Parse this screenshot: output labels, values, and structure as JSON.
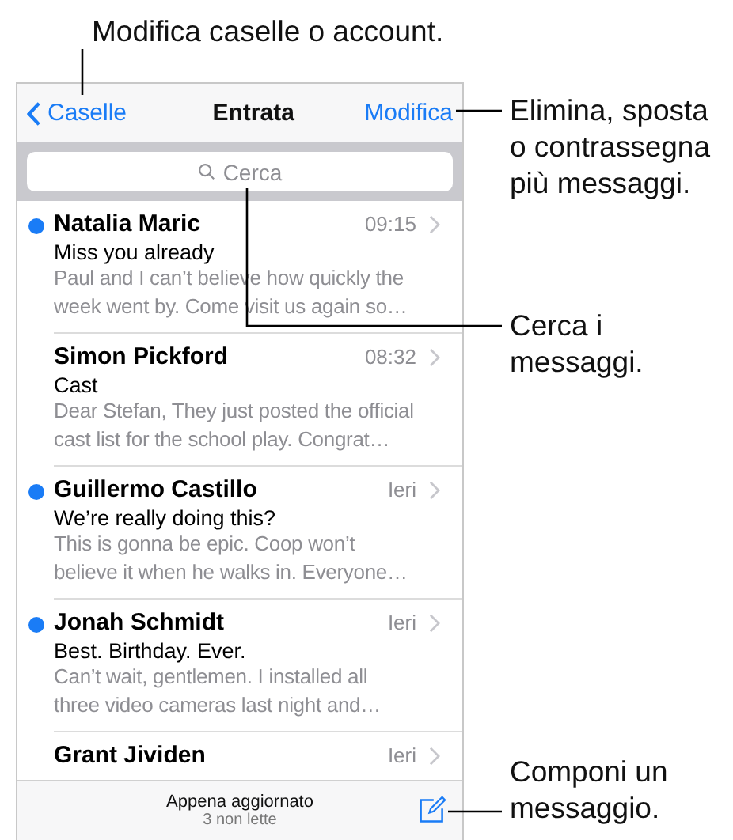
{
  "callouts": [
    {
      "lines": [
        "Modifica caselle o account."
      ]
    },
    {
      "lines": [
        "Elimina, sposta",
        "o contrassegna",
        "più messaggi."
      ]
    },
    {
      "lines": [
        "Cerca i",
        "messaggi."
      ]
    },
    {
      "lines": [
        "Componi un",
        "messaggio."
      ]
    }
  ],
  "nav": {
    "back": "Caselle",
    "title": "Entrata",
    "edit": "Modifica"
  },
  "search": {
    "placeholder": "Cerca"
  },
  "messages": [
    {
      "sender": "Natalia Maric",
      "time": "09:15",
      "unread": true,
      "subject": "Miss you already",
      "preview": [
        "Paul and I can’t believe how quickly the",
        "week went by. Come visit us again so…"
      ]
    },
    {
      "sender": "Simon Pickford",
      "time": "08:32",
      "unread": false,
      "subject": "Cast",
      "preview": [
        "Dear Stefan, They just posted the official",
        "cast list for the school play. Congrat…"
      ]
    },
    {
      "sender": "Guillermo Castillo",
      "time": "Ieri",
      "unread": true,
      "subject": "We’re really doing this?",
      "preview": [
        "This is gonna be epic. Coop won’t",
        "believe it when he walks in. Everyone…"
      ]
    },
    {
      "sender": "Jonah Schmidt",
      "time": "Ieri",
      "unread": true,
      "subject": "Best. Birthday. Ever.",
      "preview": [
        "Can’t wait, gentlemen. I installed all",
        "three video cameras last night and…"
      ]
    },
    {
      "sender": "Grant Jividen",
      "time": "Ieri",
      "unread": false
    }
  ],
  "toolbar": {
    "status": "Appena aggiornato",
    "count": "3 non lette"
  }
}
